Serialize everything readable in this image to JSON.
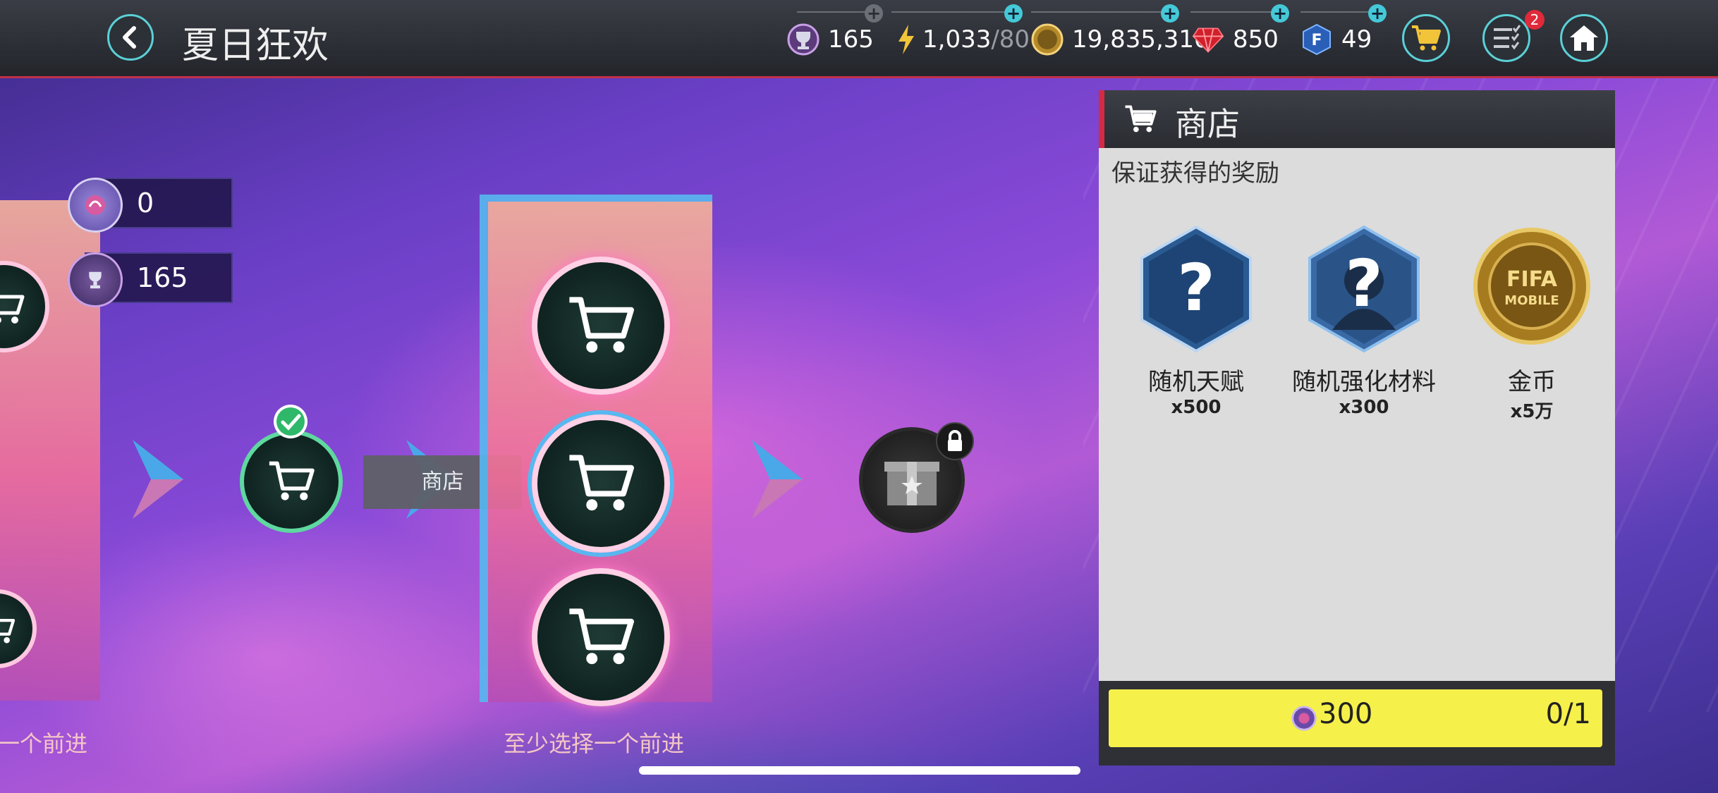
{
  "header": {
    "title": "夏日狂欢",
    "resources": {
      "trophies": "165",
      "energy": "1,033",
      "energy_max": "/80",
      "coins": "19,835,310",
      "gems": "850",
      "fifa_points": "49"
    },
    "tasks_badge": "2"
  },
  "stage": {
    "token_count": "0",
    "trophy_count": "165",
    "node_label": "商店",
    "prompt_left": "一个前进",
    "prompt_center": "至少选择一个前进"
  },
  "shop": {
    "title": "商店",
    "subtitle": "保证获得的奖励",
    "rewards": [
      {
        "name": "随机天赋",
        "amount": "x500"
      },
      {
        "name": "随机强化材料",
        "amount": "x300"
      },
      {
        "name": "金币",
        "amount": "x5万"
      }
    ],
    "coin_text_line1": "FIFA",
    "coin_text_line2": "MOBILE",
    "price": "300",
    "purchase_count": "0/1"
  },
  "colors": {
    "accent_cyan": "#5ad0d6",
    "buy_button": "#f6f04a",
    "header_red": "#d42a44"
  }
}
